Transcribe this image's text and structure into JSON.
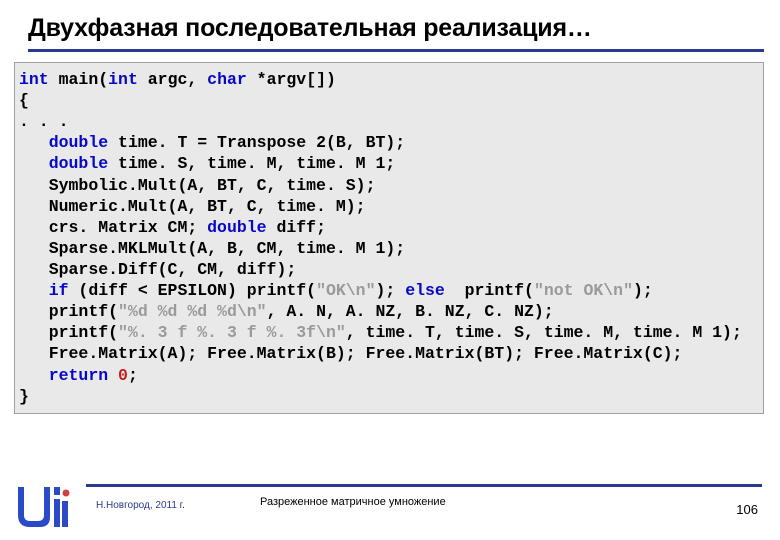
{
  "title": "Двухфазная последовательная реализация…",
  "code": {
    "l1a": "int",
    "l1b": " main(",
    "l1c": "int",
    "l1d": " argc, ",
    "l1e": "char",
    "l1f": " *argv[])",
    "l2": "{",
    "l3": ". . .",
    "l4a": "double",
    "l4b": " time. T = Transpose 2(B, BT);",
    "l5a": "double",
    "l5b": " time. S, time. M, time. M 1;",
    "l6": "Symbolic.Mult(A, BT, C, time. S);",
    "l7": "Numeric.Mult(A, BT, C, time. M);",
    "l8a": "crs. Matrix CM; ",
    "l8b": "double",
    "l8c": " diff;",
    "l9": "Sparse.MKLMult(A, B, CM, time. M 1);",
    "l10": "Sparse.Diff(C, CM, diff);",
    "l11a": "if",
    "l11b": " (diff < EPSILON) printf(",
    "l11c": "\"OK\\n\"",
    "l11d": "); ",
    "l11e": "else",
    "l11f": "  printf(",
    "l11g": "\"not OK\\n\"",
    "l11h": ");",
    "l12a": "printf(",
    "l12b": "\"%d %d %d %d\\n\"",
    "l12c": ", A. N, A. NZ, B. NZ, C. NZ);",
    "l13a": "printf(",
    "l13b": "\"%. 3 f %. 3 f %. 3f\\n\"",
    "l13c": ", time. T, time. S, time. M, time. M 1);",
    "l14": "Free.Matrix(A); Free.Matrix(B); Free.Matrix(BT); Free.Matrix(C);",
    "l15a": "return",
    "l15b": " ",
    "l15c": "0",
    "l15d": ";",
    "l16": "}"
  },
  "footer": {
    "left": "Н.Новгород, 2011 г.",
    "center": "Разреженное матричное умножение",
    "page": "106"
  }
}
